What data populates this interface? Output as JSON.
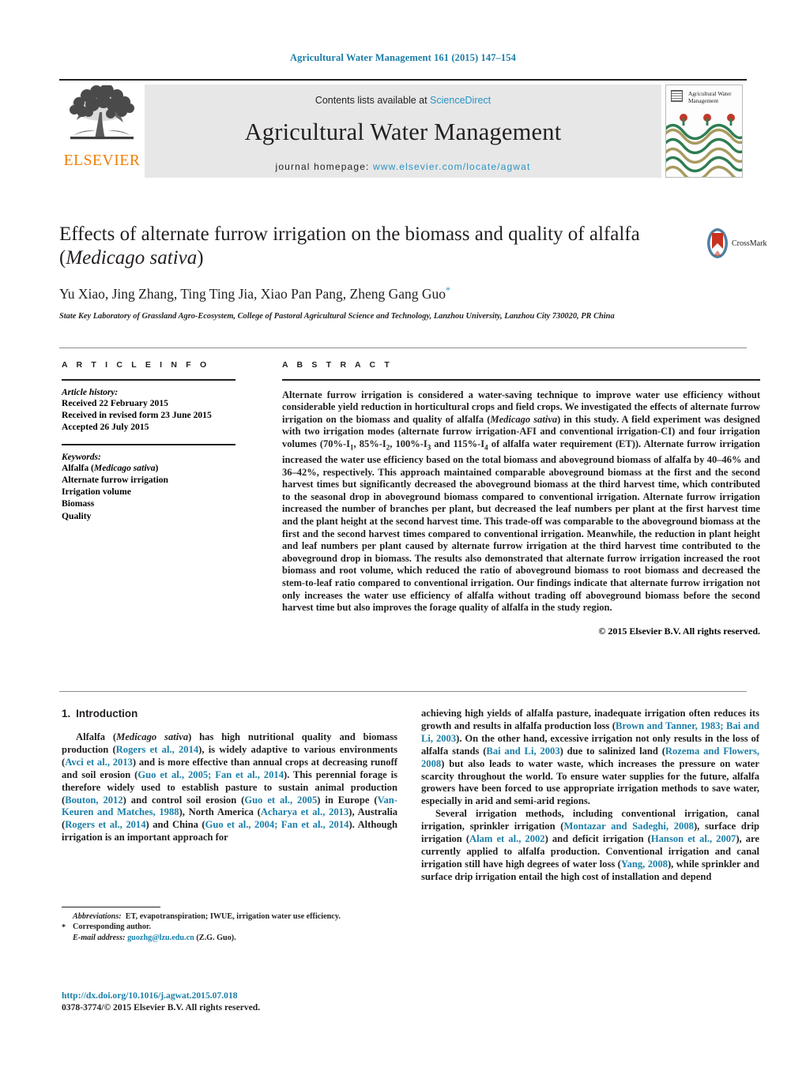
{
  "running_head": "Agricultural Water Management 161 (2015) 147–154",
  "masthead": {
    "contents_prefix": "Contents lists available at ",
    "contents_link": "ScienceDirect",
    "journal_title": "Agricultural Water Management",
    "homepage_prefix": "journal homepage: ",
    "homepage_url": "www.elsevier.com/locate/agwat",
    "publisher_logo_word": "ELSEVIER",
    "publisher_logo_icon": "elsevier-tree-icon",
    "cover_title": "Agricultural Water Management",
    "cover_icon": "journal-cover-art"
  },
  "article": {
    "title_part1": "Effects of alternate furrow irrigation on the biomass and quality of alfalfa (",
    "title_italic": "Medicago sativa",
    "title_part2": ")",
    "authors": "Yu Xiao, Jing Zhang, Ting Ting Jia, Xiao Pan Pang, Zheng Gang Guo",
    "author_marker": "*",
    "affiliation": "State Key Laboratory of Grassland Agro-Ecosystem, College of Pastoral Agricultural Science and Technology, Lanzhou University, Lanzhou City 730020, PR China",
    "crossmark_label": "CrossMark",
    "crossmark_icon": "crossmark-icon"
  },
  "article_info": {
    "heading": "A R T I C L E   I N F O",
    "history_label": "Article history:",
    "history": [
      "Received 22 February 2015",
      "Received in revised form 23 June 2015",
      "Accepted 26 July 2015"
    ],
    "keywords_label": "Keywords:",
    "keywords": [
      "Alfalfa (Medicago sativa)",
      "Alternate furrow irrigation",
      "Irrigation volume",
      "Biomass",
      "Quality"
    ],
    "keyword_italic_part": "Medicago sativa"
  },
  "abstract": {
    "heading": "A B S T R A C T",
    "paragraph_segments": [
      "Alternate furrow irrigation is considered a water-saving technique to improve water use efficiency without considerable yield reduction in horticultural crops and field crops. We investigated the effects of alternate furrow irrigation on the biomass and quality of alfalfa (",
      "Medicago sativa",
      ") in this study. A field experiment was designed with two irrigation modes (alternate furrow irrigation-AFI and conventional irrigation-CI) and four irrigation volumes (70%-I",
      "1",
      ", 85%-I",
      "2",
      ", 100%-I",
      "3",
      " and 115%-I",
      "4",
      " of alfalfa water requirement (ET)). Alternate furrow irrigation increased the water use efficiency based on the total biomass and aboveground biomass of alfalfa by 40–46% and 36–42%, respectively. This approach maintained comparable aboveground biomass at the first and the second harvest times but significantly decreased the aboveground biomass at the third harvest time, which contributed to the seasonal drop in aboveground biomass compared to conventional irrigation. Alternate furrow irrigation increased the number of branches per plant, but decreased the leaf numbers per plant at the first harvest time and the plant height at the second harvest time. This trade-off was comparable to the aboveground biomass at the first and the second harvest times compared to conventional irrigation. Meanwhile, the reduction in plant height and leaf numbers per plant caused by alternate furrow irrigation at the third harvest time contributed to the aboveground drop in biomass. The results also demonstrated that alternate furrow irrigation increased the root biomass and root volume, which reduced the ratio of aboveground biomass to root biomass and decreased the stem-to-leaf ratio compared to conventional irrigation. Our findings indicate that alternate furrow irrigation not only increases the water use efficiency of alfalfa without trading off aboveground biomass before the second harvest time but also improves the forage quality of alfalfa in the study region."
    ],
    "copyright": "© 2015 Elsevier B.V. All rights reserved."
  },
  "introduction": {
    "number": "1.",
    "title": "Introduction",
    "left_paragraph_1_segments": [
      {
        "t": "Alfalfa (",
        "k": "text"
      },
      {
        "t": "Medicago sativa",
        "k": "italic"
      },
      {
        "t": ") has high nutritional quality and biomass production (",
        "k": "text"
      },
      {
        "t": "Rogers et al., 2014",
        "k": "cite"
      },
      {
        "t": "), is widely adaptive to various environments (",
        "k": "text"
      },
      {
        "t": "Avci et al., 2013",
        "k": "cite"
      },
      {
        "t": ") and is more effective than annual crops at decreasing runoff and soil erosion (",
        "k": "text"
      },
      {
        "t": "Guo et al., 2005; Fan et al., 2014",
        "k": "cite"
      },
      {
        "t": "). This perennial forage is therefore widely used to establish pasture to sustain animal production (",
        "k": "text"
      },
      {
        "t": "Bouton, 2012",
        "k": "cite"
      },
      {
        "t": ") and control soil erosion (",
        "k": "text"
      },
      {
        "t": "Guo et al., 2005",
        "k": "cite"
      },
      {
        "t": ") in Europe (",
        "k": "text"
      },
      {
        "t": "Van-Keuren and Matches, 1988",
        "k": "cite"
      },
      {
        "t": "), North America (",
        "k": "text"
      },
      {
        "t": "Acharya et al., 2013",
        "k": "cite"
      },
      {
        "t": "), Australia (",
        "k": "text"
      },
      {
        "t": "Rogers et al., 2014",
        "k": "cite"
      },
      {
        "t": ") and China (",
        "k": "text"
      },
      {
        "t": "Guo et al., 2004; Fan et al., 2014",
        "k": "cite"
      },
      {
        "t": "). Although irrigation is an important approach for",
        "k": "text"
      }
    ],
    "right_paragraph_1_segments": [
      {
        "t": "achieving high yields of alfalfa pasture, inadequate irrigation often reduces its growth and results in alfalfa production loss (",
        "k": "text"
      },
      {
        "t": "Brown and Tanner, 1983; Bai and Li, 2003",
        "k": "cite"
      },
      {
        "t": "). On the other hand, excessive irrigation not only results in the loss of alfalfa stands (",
        "k": "text"
      },
      {
        "t": "Bai and Li, 2003",
        "k": "cite"
      },
      {
        "t": ") due to salinized land (",
        "k": "text"
      },
      {
        "t": "Rozema and Flowers, 2008",
        "k": "cite"
      },
      {
        "t": ") but also leads to water waste, which increases the pressure on water scarcity throughout the world. To ensure water supplies for the future, alfalfa growers have been forced to use appropriate irrigation methods to save water, especially in arid and semi-arid regions.",
        "k": "text"
      }
    ],
    "right_paragraph_2_segments": [
      {
        "t": "Several irrigation methods, including conventional irrigation, canal irrigation, sprinkler irrigation (",
        "k": "text"
      },
      {
        "t": "Montazar and Sadeghi, 2008",
        "k": "cite"
      },
      {
        "t": "), surface drip irrigation (",
        "k": "text"
      },
      {
        "t": "Alam et al., 2002",
        "k": "cite"
      },
      {
        "t": ") and deficit irrigation (",
        "k": "text"
      },
      {
        "t": "Hanson et al., 2007",
        "k": "cite"
      },
      {
        "t": "), are currently applied to alfalfa production. Conventional irrigation and canal irrigation still have high degrees of water loss (",
        "k": "text"
      },
      {
        "t": "Yang, 2008",
        "k": "cite"
      },
      {
        "t": "), while sprinkler and surface drip irrigation entail the high cost of installation and depend",
        "k": "text"
      }
    ]
  },
  "footnotes": {
    "abbrev_label": "Abbreviations:",
    "abbrev_text": "ET, evapotranspiration; IWUE, irrigation water use efficiency.",
    "corresponding_marker": "*",
    "corresponding_text": "Corresponding author.",
    "email_label": "E-mail address:",
    "email": "guozhg@lzu.edu.cn",
    "email_suffix": "(Z.G. Guo).",
    "doi": "http://dx.doi.org/10.1016/j.agwat.2015.07.018",
    "issn": "0378-3774/© 2015 Elsevier B.V. All rights reserved."
  },
  "colors": {
    "link": "#1b7fa8",
    "science_direct": "#2b93c4",
    "elsevier_orange": "#f07d00",
    "band_gray": "#e7e7e7"
  }
}
